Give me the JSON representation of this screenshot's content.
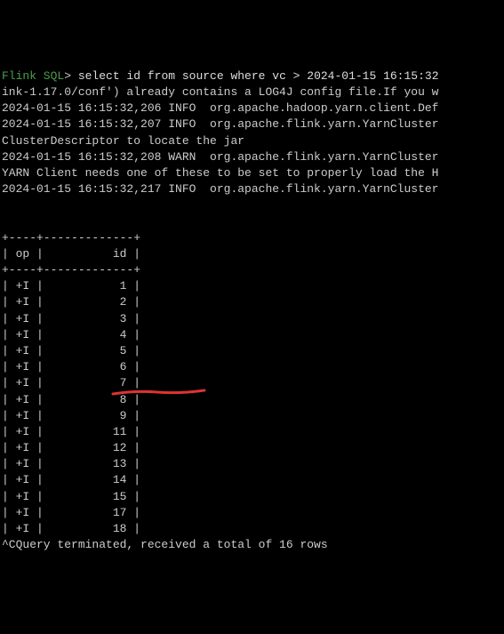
{
  "prompt": {
    "label": "Flink SQL",
    "separator": "> ",
    "command": "select id from source where vc > 2024-01-15 16:15:32"
  },
  "logs": [
    "ink-1.17.0/conf') already contains a LOG4J config file.If you w",
    "2024-01-15 16:15:32,206 INFO  org.apache.hadoop.yarn.client.Def",
    "2024-01-15 16:15:32,207 INFO  org.apache.flink.yarn.YarnCluster",
    "ClusterDescriptor to locate the jar",
    "2024-01-15 16:15:32,208 WARN  org.apache.flink.yarn.YarnCluster",
    "YARN Client needs one of these to be set to properly load the H",
    "2024-01-15 16:15:32,217 INFO  org.apache.flink.yarn.YarnCluster"
  ],
  "table": {
    "headers": {
      "op": "op",
      "id": "id"
    },
    "rows": [
      {
        "op": "+I",
        "id": "1"
      },
      {
        "op": "+I",
        "id": "2"
      },
      {
        "op": "+I",
        "id": "3"
      },
      {
        "op": "+I",
        "id": "4"
      },
      {
        "op": "+I",
        "id": "5"
      },
      {
        "op": "+I",
        "id": "6"
      },
      {
        "op": "+I",
        "id": "7"
      },
      {
        "op": "+I",
        "id": "8"
      },
      {
        "op": "+I",
        "id": "9"
      },
      {
        "op": "+I",
        "id": "11"
      },
      {
        "op": "+I",
        "id": "12"
      },
      {
        "op": "+I",
        "id": "13"
      },
      {
        "op": "+I",
        "id": "14"
      },
      {
        "op": "+I",
        "id": "15"
      },
      {
        "op": "+I",
        "id": "17"
      },
      {
        "op": "+I",
        "id": "18"
      }
    ]
  },
  "footer": "^CQuery terminated, received a total of 16 rows",
  "annotation_color": "#d33"
}
